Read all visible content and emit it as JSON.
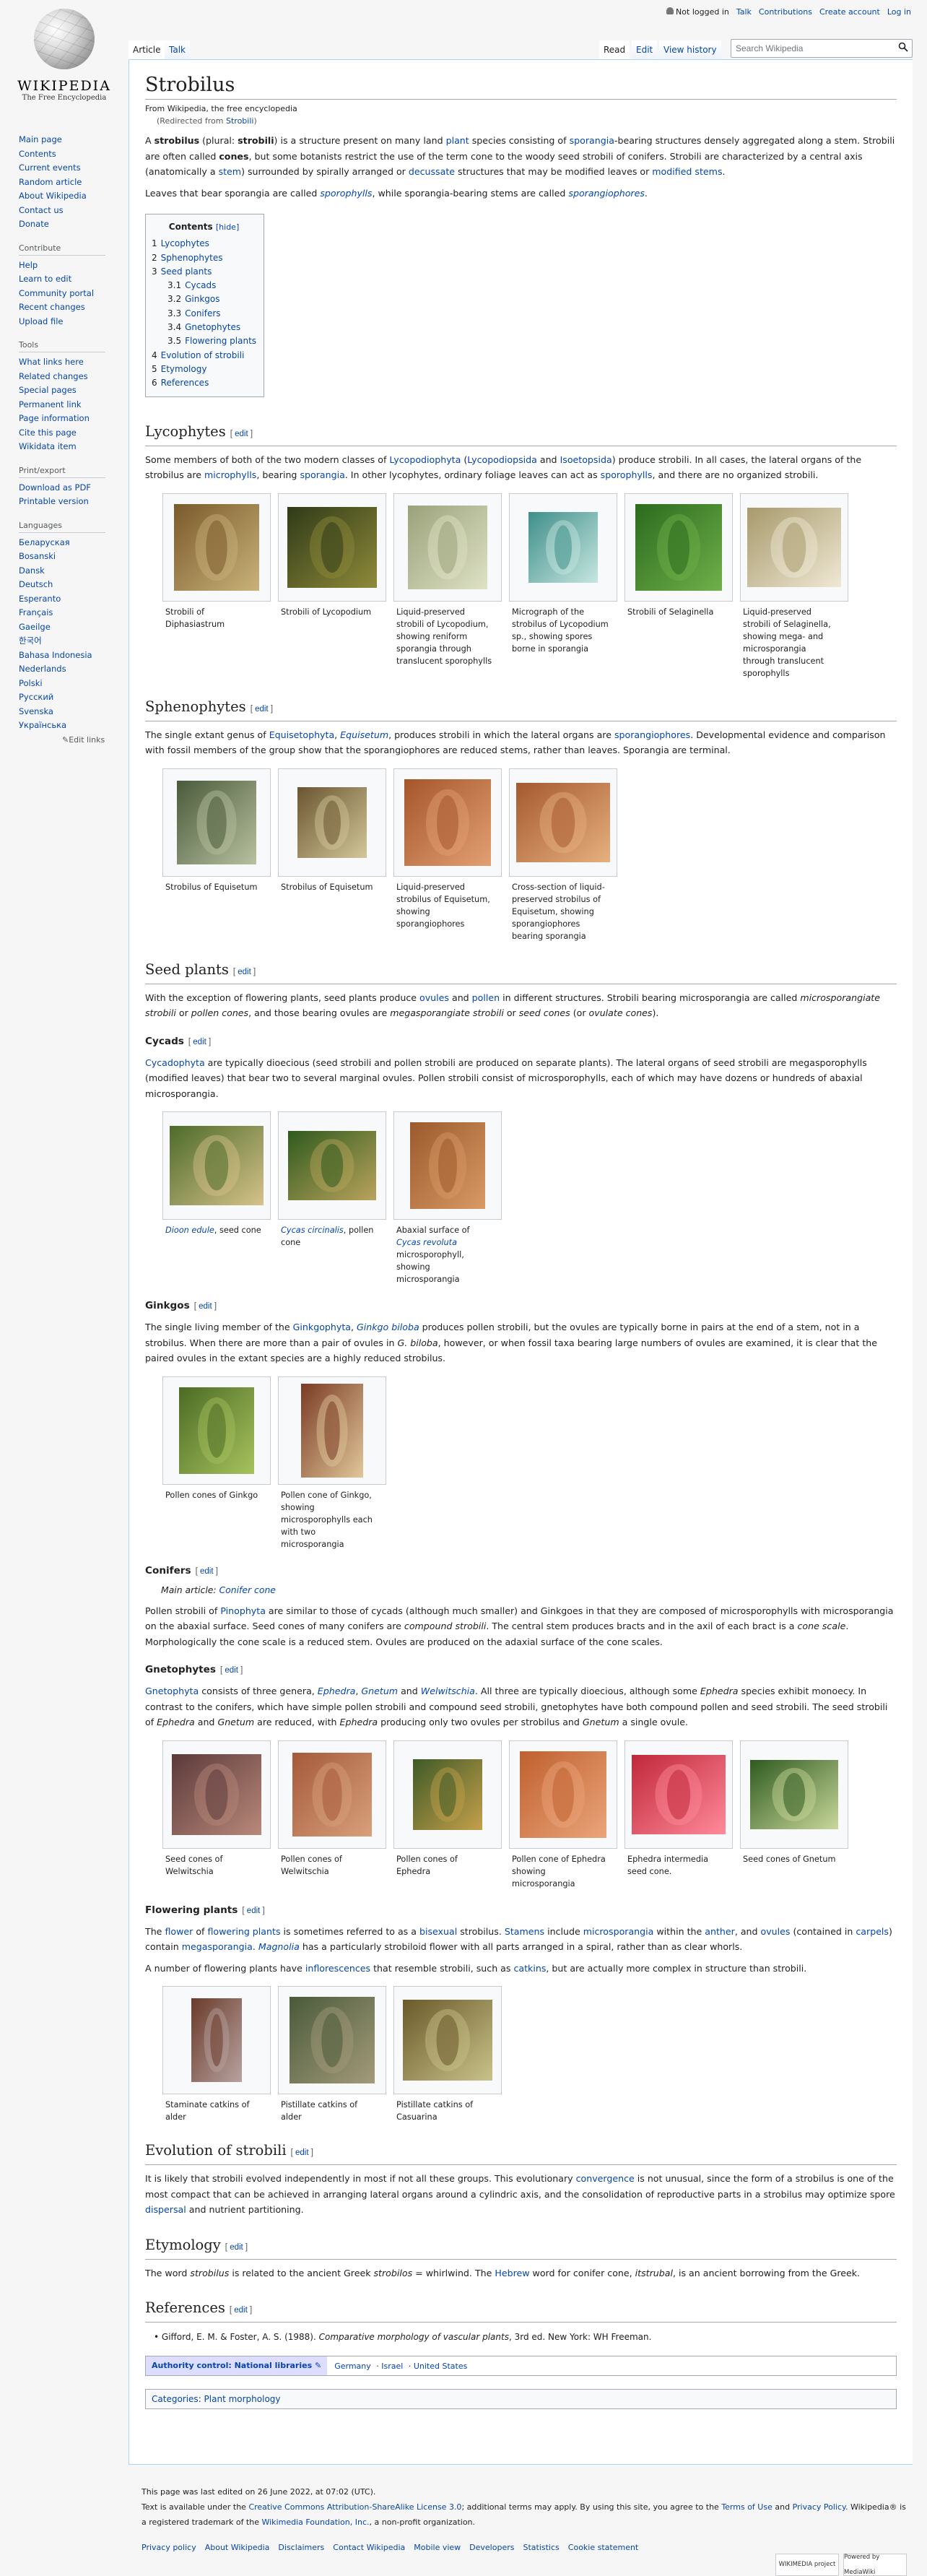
{
  "personal": {
    "not_logged_in": "Not logged in",
    "talk": "Talk",
    "contributions": "Contributions",
    "create_account": "Create account",
    "log_in": "Log in"
  },
  "logo": {
    "wordmark": "WIKIPEDIA",
    "tagline": "The Free Encyclopedia"
  },
  "sidebar": {
    "nav": [
      "Main page",
      "Contents",
      "Current events",
      "Random article",
      "About Wikipedia",
      "Contact us",
      "Donate"
    ],
    "contribute_heading": "Contribute",
    "contribute": [
      "Help",
      "Learn to edit",
      "Community portal",
      "Recent changes",
      "Upload file"
    ],
    "tools_heading": "Tools",
    "tools": [
      "What links here",
      "Related changes",
      "Special pages",
      "Permanent link",
      "Page information",
      "Cite this page",
      "Wikidata item"
    ],
    "print_heading": "Print/export",
    "print": [
      "Download as PDF",
      "Printable version"
    ],
    "languages_heading": "Languages",
    "languages": [
      "Беларуская",
      "Bosanski",
      "Dansk",
      "Deutsch",
      "Esperanto",
      "Français",
      "Gaeilge",
      "한국어",
      "Bahasa Indonesia",
      "Nederlands",
      "Polski",
      "Русский",
      "Svenska",
      "Українська"
    ],
    "edit_links": "Edit links"
  },
  "tabs": {
    "article": "Article",
    "talk": "Talk",
    "read": "Read",
    "edit": "Edit",
    "history": "View history"
  },
  "search": {
    "placeholder": "Search Wikipedia"
  },
  "article": {
    "title": "Strobilus",
    "tagline": "From Wikipedia, the free encyclopedia",
    "redirected_prefix": "(Redirected from ",
    "redirected_link": "Strobili",
    "redirected_suffix": ")",
    "intro1_a": "A ",
    "intro1_b": "strobilus",
    "intro1_c": " (plural: ",
    "intro1_d": "strobili",
    "intro1_e": ") is a structure present on many land ",
    "intro1_plant": "plant",
    "intro1_f": " species consisting of ",
    "intro1_sporangia": "sporangia",
    "intro1_g": "-bearing structures densely aggregated along a stem. Strobili are often called ",
    "intro1_cones": "cones",
    "intro1_h": ", but some botanists restrict the use of the term cone to the woody seed strobili of conifers. Strobili are characterized by a central axis (anatomically a ",
    "intro1_stem": "stem",
    "intro1_i": ") surrounded by spirally arranged or ",
    "intro1_decussate": "decussate",
    "intro1_j": " structures that may be modified leaves or ",
    "intro1_modstems": "modified stems",
    "intro1_k": ".",
    "intro2_a": "Leaves that bear sporangia are called ",
    "intro2_sporophylls": "sporophylls",
    "intro2_b": ", while sporangia-bearing stems are called ",
    "intro2_sporangiophores": "sporangiophores",
    "intro2_c": "."
  },
  "toc": {
    "title": "Contents",
    "hide": "[hide]",
    "items": [
      {
        "num": "1",
        "label": "Lycophytes",
        "level": 1
      },
      {
        "num": "2",
        "label": "Sphenophytes",
        "level": 1
      },
      {
        "num": "3",
        "label": "Seed plants",
        "level": 1
      },
      {
        "num": "3.1",
        "label": "Cycads",
        "level": 2
      },
      {
        "num": "3.2",
        "label": "Ginkgos",
        "level": 2
      },
      {
        "num": "3.3",
        "label": "Conifers",
        "level": 2
      },
      {
        "num": "3.4",
        "label": "Gnetophytes",
        "level": 2
      },
      {
        "num": "3.5",
        "label": "Flowering plants",
        "level": 2
      },
      {
        "num": "4",
        "label": "Evolution of strobili",
        "level": 1
      },
      {
        "num": "5",
        "label": "Etymology",
        "level": 1
      },
      {
        "num": "6",
        "label": "References",
        "level": 1
      }
    ]
  },
  "edit_label": "edit",
  "lycophytes": {
    "heading": "Lycophytes",
    "p_a": "Some members of both of the two modern classes of ",
    "p_lyco": "Lycopodiophyta",
    "p_b": " (",
    "p_lycopsida": "Lycopodiopsida",
    "p_c": " and ",
    "p_iso": "Isoetopsida",
    "p_d": ") produce strobili. In all cases, the lateral organs of the strobilus are ",
    "p_micro": "microphylls",
    "p_e": ", bearing ",
    "p_spor": "sporangia",
    "p_f": ". In other lycophytes, ordinary foliage leaves can act as ",
    "p_sporoph": "sporophylls",
    "p_g": ", and there are no organized strobili.",
    "gallery": [
      {
        "cap": "Strobili of Diphasiastrum",
        "c1": "#7a5a2b",
        "c2": "#c9b27a"
      },
      {
        "cap": "Strobili of Lycopodium",
        "c1": "#2f3a17",
        "c2": "#8f8a3a"
      },
      {
        "cap": "Liquid-preserved strobili of Lycopodium, showing reniform sporangia through translucent sporophylls",
        "c1": "#9aa27a",
        "c2": "#dfe2c6"
      },
      {
        "cap": "Micrograph of the strobilus of Lycopodium sp., showing spores borne in sporangia",
        "c1": "#3f8f8a",
        "c2": "#c7e6e0"
      },
      {
        "cap": "Strobili of Selaginella",
        "c1": "#2c6a1e",
        "c2": "#6fb04a"
      },
      {
        "cap": "Liquid-preserved strobili of Selaginella, showing mega- and microsporangia through translucent sporophylls",
        "c1": "#a89a6c",
        "c2": "#efe8d4"
      }
    ]
  },
  "sphenophytes": {
    "heading": "Sphenophytes",
    "p_a": "The single extant genus of ",
    "p_equ": "Equisetophyta",
    "p_b": ", ",
    "p_equi": "Equisetum",
    "p_c": ", produces strobili in which the lateral organs are ",
    "p_spor": "sporangiophores",
    "p_d": ". Developmental evidence and comparison with fossil members of the group show that the sporangiophores are reduced stems, rather than leaves. Sporangia are terminal.",
    "gallery": [
      {
        "cap": "Strobilus of Equisetum",
        "c1": "#4a5a3a",
        "c2": "#b8c1a0"
      },
      {
        "cap": "Strobilus of Equisetum",
        "c1": "#6a5530",
        "c2": "#d3c79a"
      },
      {
        "cap": "Liquid-preserved strobilus of Equisetum, showing sporangiophores",
        "c1": "#a5552b",
        "c2": "#e2a073"
      },
      {
        "cap": "Cross-section of liquid-preserved strobilus of Equisetum, showing sporangiophores bearing sporangia",
        "c1": "#a5592f",
        "c2": "#e6b07f"
      }
    ]
  },
  "seed": {
    "heading": "Seed plants",
    "p_a": "With the exception of flowering plants, seed plants produce ",
    "p_ovules": "ovules",
    "p_b": " and ",
    "p_pollen": "pollen",
    "p_c": " in different structures. Strobili bearing microsporangia are called ",
    "p_d": "microsporangiate strobili",
    "p_e": " or ",
    "p_f": "pollen cones",
    "p_g": ", and those bearing ovules are ",
    "p_h": "megasporangiate strobili",
    "p_i": " or ",
    "p_j": "seed cones",
    "p_k": " (or ",
    "p_l": "ovulate cones",
    "p_m": ")."
  },
  "cycads": {
    "heading": "Cycads",
    "p_link": "Cycadophyta",
    "p_a": " are typically dioecious (seed strobili and pollen strobili are produced on separate plants). The lateral organs of seed strobili are megasporophylls (modified leaves) that bear two to several marginal ovules. Pollen strobili consist of microsporophylls, each of which may have dozens or hundreds of abaxial microsporangia.",
    "gallery": [
      {
        "cap_l": "Dioon edule",
        "cap_r": ", seed cone",
        "c1": "#4d6b2a",
        "c2": "#d6c28a"
      },
      {
        "cap_l": "Cycas circinalis",
        "cap_r": ", pollen cone",
        "c1": "#2f5a1e",
        "c2": "#b9a35c"
      },
      {
        "cap_l": "",
        "cap_pre": "Abaxial surface of ",
        "cap_link": "Cycas revoluta",
        "cap_r": " microsporophyll, showing microsporangia",
        "c1": "#9c5a2c",
        "c2": "#d99a66"
      }
    ]
  },
  "ginkgos": {
    "heading": "Ginkgos",
    "p_a": "The single living member of the ",
    "p_g1": "Ginkgophyta",
    "p_b": ", ",
    "p_g2": "Ginkgo biloba",
    "p_c": " produces pollen strobili, but the ovules are typically borne in pairs at the end of a stem, not in a strobilus. When there are more than a pair of ovules in ",
    "p_d": "G. biloba",
    "p_e": ", however, or when fossil taxa bearing large numbers of ovules are examined, it is clear that the paired ovules in the extant species are a highly reduced strobilus.",
    "gallery": [
      {
        "cap": "Pollen cones of Ginkgo",
        "c1": "#4c6b24",
        "c2": "#a7c25e"
      },
      {
        "cap": "Pollen cone of Ginkgo, showing microsporophylls each with two microsporangia",
        "c1": "#7a3b25",
        "c2": "#e1c79a"
      }
    ]
  },
  "conifers": {
    "heading": "Conifers",
    "main_prefix": "Main article: ",
    "main_link": "Conifer cone",
    "p_a": "Pollen strobili of ",
    "p_pin": "Pinophyta",
    "p_b": " are similar to those of cycads (although much smaller) and Ginkgoes in that they are composed of microsporophylls with microsporangia on the abaxial surface. Seed cones of many conifers are ",
    "p_c": "compound strobili",
    "p_d": ". The central stem produces bracts and in the axil of each bract is a ",
    "p_e": "cone scale",
    "p_f": ". Morphologically the cone scale is a reduced stem. Ovules are produced on the adaxial surface of the cone scales."
  },
  "gnetophytes": {
    "heading": "Gnetophytes",
    "p_gn": "Gnetophyta",
    "p_a": " consists of three genera, ",
    "p_eph": "Ephedra",
    "p_b": ", ",
    "p_gne": "Gnetum",
    "p_c": " and ",
    "p_wel": "Welwitschia",
    "p_d": ". All three are typically dioecious, although some ",
    "p_e": "Ephedra",
    "p_f": " species exhibit monoecy. In contrast to the conifers, which have simple pollen strobili and compound seed strobili, gnetophytes have both compound pollen and seed strobili. The seed strobili of ",
    "p_g": "Ephedra",
    "p_h": " and ",
    "p_i": "Gnetum",
    "p_j": " are reduced, with ",
    "p_k": "Ephedra",
    "p_l": " producing only two ovules per strobilus and ",
    "p_m": "Gnetum",
    "p_n": " a single ovule.",
    "gallery": [
      {
        "cap": "Seed cones of Welwitschia",
        "c1": "#5b3a3a",
        "c2": "#b9887a"
      },
      {
        "cap": "Pollen cones of Welwitschia",
        "c1": "#a55a3a",
        "c2": "#d8a07c"
      },
      {
        "cap": "Pollen cones of Ephedra",
        "c1": "#3f5a28",
        "c2": "#c4a04a"
      },
      {
        "cap": "Pollen cone of Ephedra showing microsporangia",
        "c1": "#c0602f",
        "c2": "#eaa57a"
      },
      {
        "cap": "Ephedra intermedia seed cone.",
        "c1": "#c0283a",
        "c2": "#ff8a9a"
      },
      {
        "cap": "Seed cones of Gnetum",
        "c1": "#2f5a20",
        "c2": "#c9d89a"
      }
    ]
  },
  "flowering": {
    "heading": "Flowering plants",
    "p1_a": "The ",
    "p1_flower": "flower",
    "p1_b": " of ",
    "p1_fp": "flowering plants",
    "p1_c": " is sometimes referred to as a ",
    "p1_bis": "bisexual",
    "p1_d": " strobilus. ",
    "p1_stam": "Stamens",
    "p1_e": " include ",
    "p1_micro": "microsporangia",
    "p1_f": " within the ",
    "p1_anth": "anther",
    "p1_g": ", and ",
    "p1_ov": "ovules",
    "p1_h": " (contained in ",
    "p1_carp": "carpels",
    "p1_i": ") contain ",
    "p1_mega": "megasporangia",
    "p1_j": ". ",
    "p1_mag": "Magnolia",
    "p1_k": " has a particularly strobiloid flower with all parts arranged in a spiral, rather than as clear whorls.",
    "p2_a": "A number of flowering plants have ",
    "p2_inf": "inflorescences",
    "p2_b": " that resemble strobili, such as ",
    "p2_cat": "catkins",
    "p2_c": ", but are actually more complex in structure than strobili.",
    "gallery": [
      {
        "cap": "Staminate catkins of alder",
        "c1": "#6a3a2a",
        "c2": "#b7a3a0"
      },
      {
        "cap": "Pistillate catkins of alder",
        "c1": "#4a5a3a",
        "c2": "#a39b7a"
      },
      {
        "cap": "Pistillate catkins of Casuarina",
        "c1": "#6a5a2a",
        "c2": "#c9c28a"
      }
    ]
  },
  "evolution": {
    "heading": "Evolution of strobili",
    "p_a": "It is likely that strobili evolved independently in most if not all these groups. This evolutionary ",
    "p_conv": "convergence",
    "p_b": " is not unusual, since the form of a strobilus is one of the most compact that can be achieved in arranging lateral organs around a cylindric axis, and the consolidation of reproductive parts in a strobilus may optimize spore ",
    "p_disp": "dispersal",
    "p_c": " and nutrient partitioning."
  },
  "etymology": {
    "heading": "Etymology",
    "p_a": "The word ",
    "p_b": "strobilus",
    "p_c": " is related to the ancient Greek ",
    "p_d": "strobilos",
    "p_e": " = whirlwind. The ",
    "p_heb": "Hebrew",
    "p_f": " word for conifer cone, ",
    "p_g": "itstrubal",
    "p_h": ", is an ancient borrowing from the Greek."
  },
  "references": {
    "heading": "References",
    "ref_a": "Gifford, E. M. & Foster, A. S. (1988). ",
    "ref_b": "Comparative morphology of vascular plants",
    "ref_c": ", 3rd ed. New York: WH Freeman."
  },
  "authority": {
    "label": "Authority control: National libraries",
    "items": [
      "Germany",
      "Israel",
      "United States"
    ]
  },
  "categories": {
    "label": "Categories",
    "items": [
      "Plant morphology"
    ]
  },
  "footer": {
    "last_edited": "This page was last edited on 26 June 2022, at 07:02 (UTC).",
    "license_a": "Text is available under the ",
    "license_link": "Creative Commons Attribution-ShareAlike License 3.0",
    "license_b": "; additional terms may apply. By using this site, you agree to the ",
    "terms": "Terms of Use",
    "license_c": " and ",
    "privacy": "Privacy Policy",
    "license_d": ". Wikipedia® is a registered trademark of the ",
    "wmf": "Wikimedia Foundation, Inc.",
    "license_e": ", a non-profit organization.",
    "links": [
      "Privacy policy",
      "About Wikipedia",
      "Disclaimers",
      "Contact Wikipedia",
      "Mobile view",
      "Developers",
      "Statistics",
      "Cookie statement"
    ],
    "badge1": "WIKIMEDIA project",
    "badge2": "Powered by MediaWiki"
  }
}
